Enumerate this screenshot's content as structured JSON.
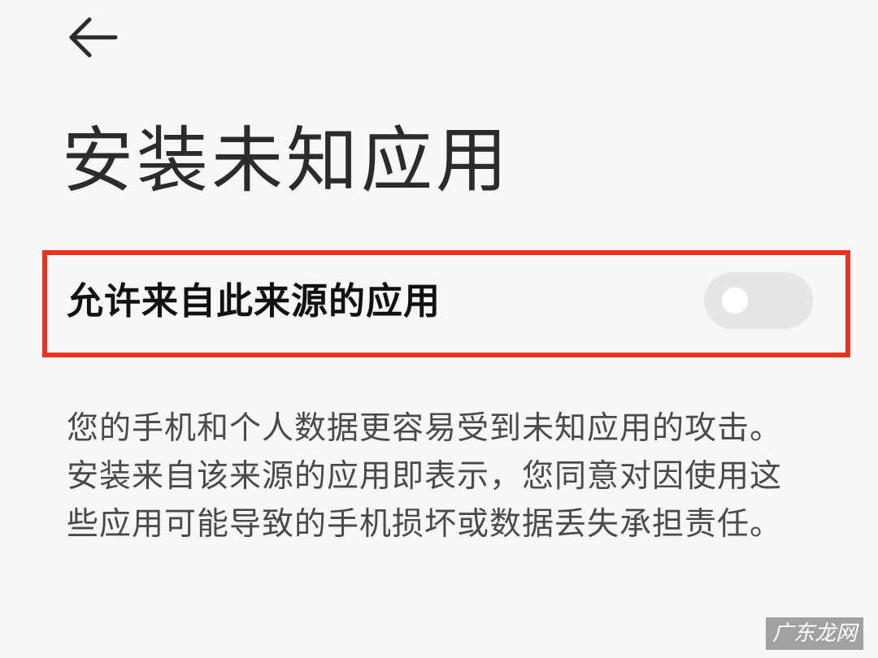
{
  "header": {
    "back_icon": "arrow-left-icon"
  },
  "page": {
    "title": "安装未知应用"
  },
  "setting": {
    "label": "允许来自此来源的应用",
    "toggle_on": false,
    "highlight_color": "#e8321e"
  },
  "description": {
    "text": "您的手机和个人数据更容易受到未知应用的攻击。安装来自该来源的应用即表示，您同意对因使用这些应用可能导致的手机损坏或数据丢失承担责任。"
  },
  "watermark": {
    "text": "广东龙网"
  }
}
